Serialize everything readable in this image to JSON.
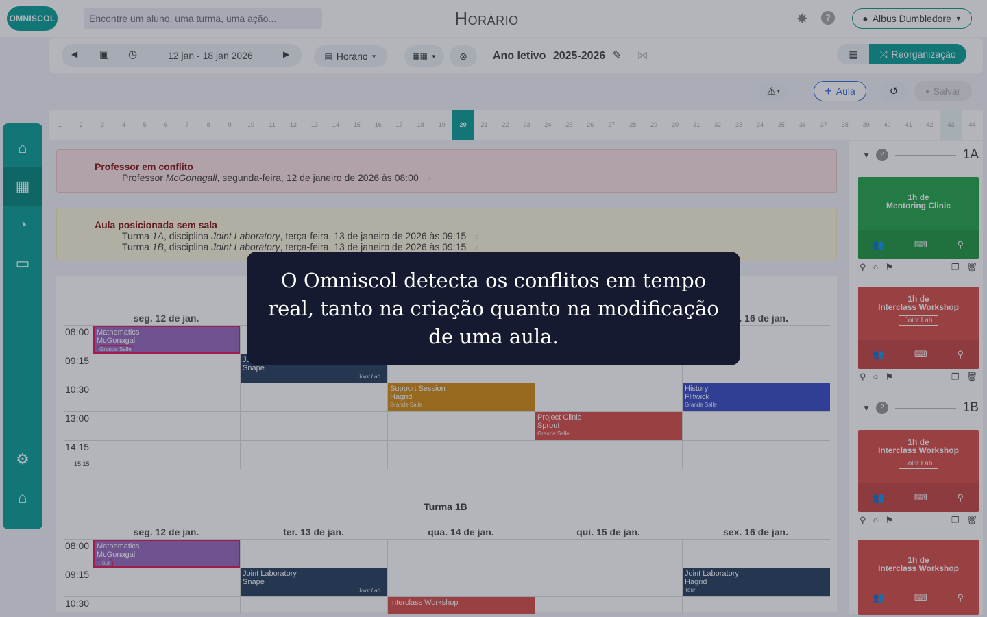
{
  "header": {
    "logo_text": "OMNISCOL",
    "search_placeholder": "Encontre um aluno, uma turma, uma ação...",
    "page_title": "Horário",
    "user_name": "Albus Dumbledore"
  },
  "toolbar": {
    "date_range": "12 jan - 18 jan 2026",
    "view_select": "Horário",
    "ano_letivo_label": "Ano letivo",
    "ano_letivo_value": "2025-2026",
    "reorg_label": "Reorganização"
  },
  "actions": {
    "aula_label": "Aula",
    "salvar_label": "Salvar"
  },
  "week_strip": [
    "1",
    "2",
    "3",
    "4",
    "5",
    "6",
    "7",
    "8",
    "9",
    "10",
    "11",
    "12",
    "13",
    "14",
    "15",
    "16",
    "17",
    "18",
    "19",
    "20",
    "21",
    "22",
    "23",
    "24",
    "25",
    "26",
    "27",
    "28",
    "29",
    "30",
    "31",
    "32",
    "33",
    "34",
    "35",
    "36",
    "37",
    "38",
    "39",
    "40",
    "41",
    "42",
    "43",
    "44"
  ],
  "alerts": {
    "conflict": {
      "title": "Professor em conflito",
      "line1_a": "Professor ",
      "line1_teacher": "McGonagall",
      "line1_b": ", segunda-feira, 12 de janeiro de 2026 às 08:00"
    },
    "noroom": {
      "title": "Aula posicionada sem sala",
      "l1_a": "Turma ",
      "l1_turma": "1A",
      "l1_b": ", disciplina ",
      "l1_disc": "Joint Laboratory",
      "l1_c": ", terça-feira, 13 de janeiro de 2026 às 09:15",
      "l2_a": "Turma ",
      "l2_turma": "1B",
      "l2_b": ", disciplina ",
      "l2_disc": "Joint Laboratory",
      "l2_c": ", terça-feira, 13 de janeiro de 2026 às 09:15"
    }
  },
  "schedule_1a": {
    "days": [
      "seg. 12 de jan.",
      "",
      "",
      "",
      "sex. 16 de jan."
    ],
    "times": [
      "08:00",
      "09:15",
      "10:30",
      "13:00",
      "14:15",
      "15:15"
    ],
    "events": {
      "math": {
        "subject": "Mathematics",
        "teacher": "McGonagall",
        "room": "Grande Salle"
      },
      "joint": {
        "subject": "Jo",
        "teacher": "Snape",
        "room": "Joint Lab"
      },
      "support": {
        "subject": "Support Session",
        "teacher": "Hagrid",
        "room": "Grande Salle"
      },
      "history": {
        "subject": "History",
        "teacher": "Flitwick",
        "room": "Grande Salle"
      },
      "project": {
        "subject": "Project Clinic",
        "teacher": "Sprout",
        "room": "Grande Salle"
      }
    }
  },
  "schedule_1b": {
    "title": "Turma 1B",
    "days": [
      "seg. 12 de jan.",
      "ter. 13 de jan.",
      "qua. 14 de jan.",
      "qui. 15 de jan.",
      "sex. 16 de jan."
    ],
    "times": [
      "08:00",
      "09:15",
      "10:30"
    ],
    "events": {
      "math": {
        "subject": "Mathematics",
        "teacher": "McGonagall",
        "room": "Tour"
      },
      "joint_tue": {
        "subject": "Joint Laboratory",
        "teacher": "Snape",
        "room": "Joint Lab"
      },
      "joint_fri": {
        "subject": "Joint Laboratory",
        "teacher": "Hagrid",
        "room": "Tour"
      },
      "interclass": {
        "subject": "Interclass Workshop"
      }
    }
  },
  "right_panel": {
    "group_1a": {
      "count": "2",
      "name": "1A"
    },
    "group_1b": {
      "count": "2",
      "name": "1B"
    },
    "cards": [
      {
        "duration": "1h de",
        "subject": "Mentoring Clinic",
        "badge": ""
      },
      {
        "duration": "1h de",
        "subject": "Interclass Workshop",
        "badge": "Joint Lab"
      },
      {
        "duration": "1h de",
        "subject": "Interclass Workshop",
        "badge": "Joint Lab"
      },
      {
        "duration": "1h de",
        "subject": "Interclass Workshop",
        "badge": ""
      }
    ],
    "ellipsis": "..."
  },
  "modal": {
    "text": "O Omniscol detecta os conflitos em tempo real, tanto na criação quanto na modificação de uma aula."
  },
  "colors": {
    "brand": "#12a39a",
    "conflict_red": "#d9534f",
    "math_purple": "#9b6fc0",
    "joint_navy": "#2f4564",
    "support_orange": "#d4901a",
    "history_blue": "#3f51c8",
    "mentoring_green": "#2ba94f"
  }
}
